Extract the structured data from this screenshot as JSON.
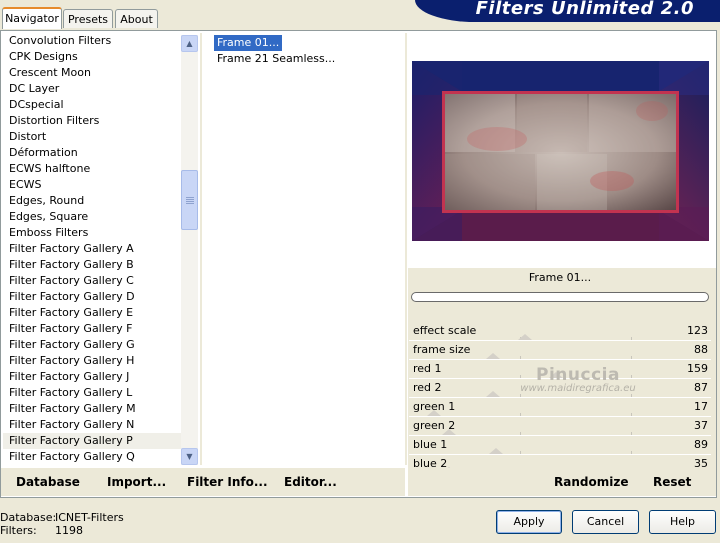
{
  "tabs": [
    {
      "label": "Navigator",
      "active": true
    },
    {
      "label": "Presets",
      "active": false
    },
    {
      "label": "About",
      "active": false
    }
  ],
  "app_title": "Filters Unlimited 2.0",
  "filter_categories": [
    "Convolution Filters",
    "CPK Designs",
    "Crescent Moon",
    "DC Layer",
    "DCspecial",
    "Distortion Filters",
    "Distort",
    "Déformation",
    "ECWS halftone",
    "ECWS",
    "Edges, Round",
    "Edges, Square",
    "Emboss Filters",
    "Filter Factory Gallery A",
    "Filter Factory Gallery B",
    "Filter Factory Gallery C",
    "Filter Factory Gallery D",
    "Filter Factory Gallery E",
    "Filter Factory Gallery F",
    "Filter Factory Gallery G",
    "Filter Factory Gallery H",
    "Filter Factory Gallery J",
    "Filter Factory Gallery L",
    "Filter Factory Gallery M",
    "Filter Factory Gallery N",
    "Filter Factory Gallery P",
    "Filter Factory Gallery Q"
  ],
  "selected_category": "Filter Factory Gallery P",
  "effects": [
    "Frame 01...",
    "Frame 21 Seamless..."
  ],
  "selected_effect": "Frame 01...",
  "preview_effect_name": "Frame 01...",
  "progress": 0,
  "parameters": [
    {
      "name": "effect scale",
      "value": "123",
      "level": 0.48
    },
    {
      "name": "frame size",
      "value": "88",
      "level": 0.34
    },
    {
      "name": "red 1",
      "value": "159",
      "level": 0.62
    },
    {
      "name": "red 2",
      "value": "87",
      "level": 0.34
    },
    {
      "name": "green 1",
      "value": "17",
      "level": 0.07
    },
    {
      "name": "green 2",
      "value": "37",
      "level": 0.14
    },
    {
      "name": "blue 1",
      "value": "89",
      "level": 0.35
    },
    {
      "name": "blue 2",
      "value": "35",
      "level": 0.14
    }
  ],
  "watermark": {
    "line1": "Pinuccia",
    "line2": "www.maidiregrafica.eu"
  },
  "left_links": [
    "Database",
    "Import...",
    "Filter Info...",
    "Editor..."
  ],
  "right_links": [
    "Randomize",
    "Reset"
  ],
  "status": {
    "database_label": "Database:",
    "database_value": "ICNET-Filters",
    "filters_label": "Filters:",
    "filters_value": "1198"
  },
  "buttons": {
    "apply": "Apply",
    "cancel": "Cancel",
    "help": "Help"
  },
  "colors": {
    "banner": "#0a1f6e",
    "selection": "#316ac5",
    "face": "#ece9d8"
  },
  "icons": {
    "scroll_up": "up-arrow",
    "scroll_down": "down-arrow"
  }
}
